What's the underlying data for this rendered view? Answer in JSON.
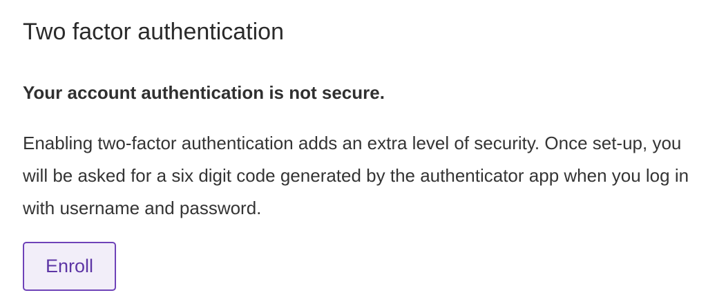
{
  "section": {
    "title": "Two factor authentication",
    "warning": "Your account authentication is not secure.",
    "description": "Enabling two-factor authentication adds an extra level of security. Once set-up, you will be asked for a six digit code generated by the authenticator app when you log in with username and password.",
    "enroll_label": "Enroll"
  },
  "colors": {
    "accent": "#6e42b8",
    "button_background": "#f2eef9",
    "text": "#2b2b2b"
  }
}
